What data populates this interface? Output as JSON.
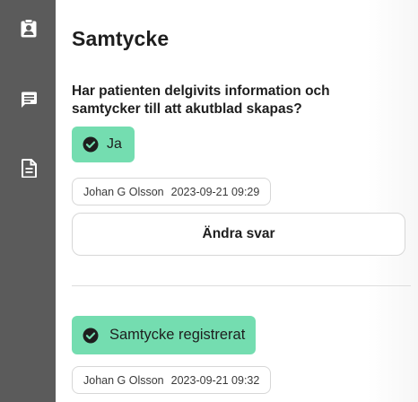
{
  "sidebar": {
    "items": [
      {
        "icon": "clipboard-user-icon"
      },
      {
        "icon": "message-icon"
      },
      {
        "icon": "document-icon"
      }
    ]
  },
  "main": {
    "title": "Samtycke",
    "question": "Har patienten delgivits information och samtycker till att akutblad skapas?",
    "answer": {
      "label": "Ja",
      "icon": "check-circle-icon",
      "user": "Johan G Olsson",
      "timestamp": "2023-09-21 09:29"
    },
    "change_button_label": "Ändra svar",
    "registration": {
      "label": "Samtycke registrerat",
      "icon": "check-circle-icon",
      "user": "Johan G Olsson",
      "timestamp": "2023-09-21 09:32"
    }
  },
  "colors": {
    "sidebar_bg": "#5b5b5b",
    "success_bg": "#74ddb0",
    "text": "#1e1e1e"
  }
}
